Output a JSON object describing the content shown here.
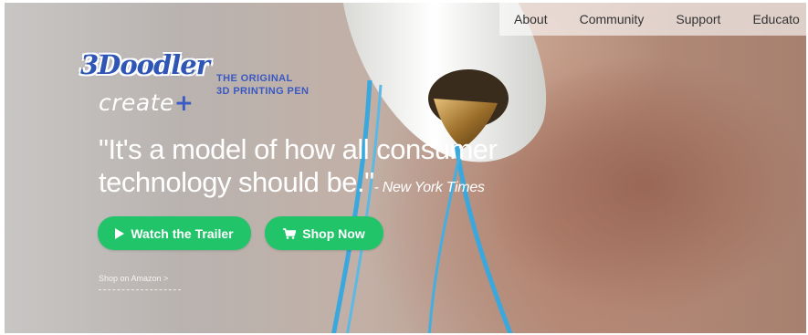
{
  "nav": {
    "items": [
      "About",
      "Community",
      "Support",
      "Educato"
    ]
  },
  "brand": {
    "logo_main": "3Doodler",
    "logo_sub": "create",
    "logo_plus": "+",
    "tagline_line1": "THE ORIGINAL",
    "tagline_line2": "3D PRINTING PEN"
  },
  "hero": {
    "quote_line1": "\"It's a model of how all consumer",
    "quote_line2": "technology should be.\"",
    "quote_source": "- New York Times"
  },
  "buttons": {
    "trailer_label": "Watch the Trailer",
    "shop_label": "Shop Now",
    "trailer_icon": "play-icon",
    "shop_icon": "cart-icon"
  },
  "links": {
    "amazon": "Shop on Amazon >"
  },
  "colors": {
    "button_green": "#22c46a",
    "brand_blue": "#2f56b5"
  }
}
